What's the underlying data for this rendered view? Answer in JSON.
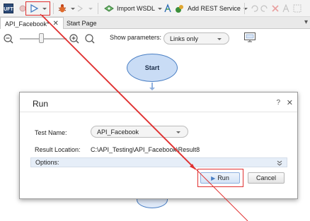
{
  "toolbar": {
    "run_tooltip": "Run",
    "import_wsdl_label": "Import WSDL",
    "add_rest_label": "Add REST Service"
  },
  "tabs": [
    {
      "label": "API_Facebook*",
      "active": true
    },
    {
      "label": "Start Page",
      "active": false
    }
  ],
  "canvas_toolbar": {
    "show_parameters_label": "Show parameters:",
    "show_parameters_value": "Links only"
  },
  "flow": {
    "start_label": "Start"
  },
  "dialog": {
    "title": "Run",
    "help": "?",
    "close": "✕",
    "test_name_label": "Test Name:",
    "test_name_value": "API_Facebook",
    "result_location_label": "Result Location:",
    "result_location_value": "C:\\API_Testing\\API_Facebook\\Result8",
    "options_label": "Options:",
    "options_chevron": "»",
    "run_button": "Run",
    "cancel_button": "Cancel"
  },
  "colors": {
    "highlight": "#e03030",
    "accent": "#4a7fc4"
  }
}
